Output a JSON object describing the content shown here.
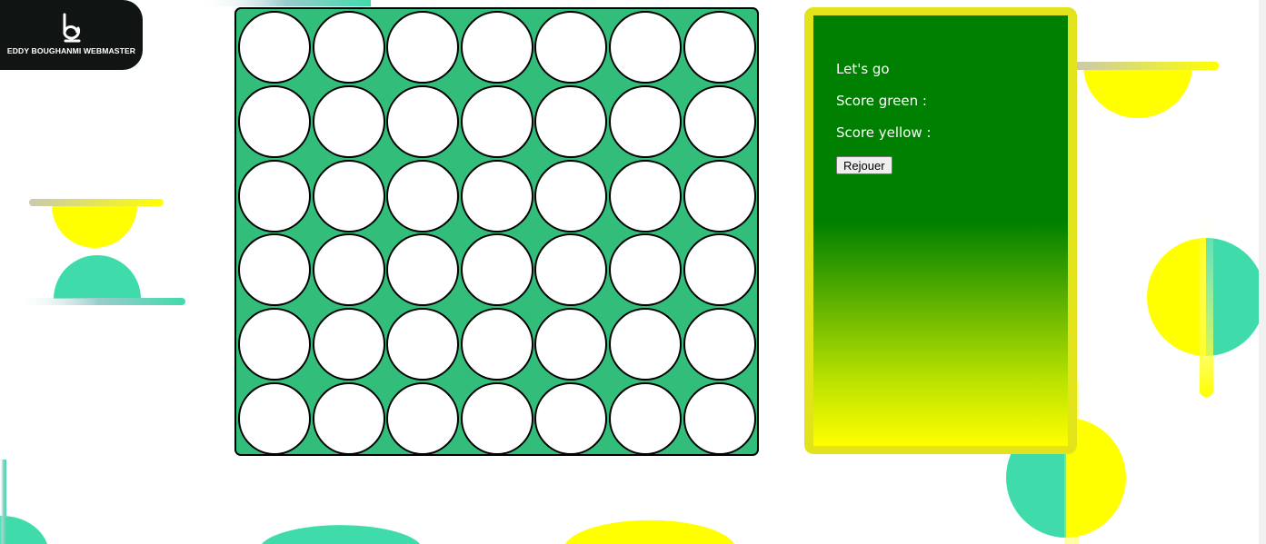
{
  "logo": {
    "mark": "b",
    "name": "EDDY BOUGHANMI WEBMASTER"
  },
  "board": {
    "rows": 6,
    "columns": 7,
    "cell_color": "#ffffff",
    "board_color": "#32bd7a"
  },
  "panel": {
    "status": "Let's go",
    "score_green_label": "Score green :",
    "score_yellow_label": "Score yellow :",
    "replay_label": "Rejouer"
  },
  "colors": {
    "green": "#008000",
    "yellow": "#ffff00",
    "teal": "#40dbab",
    "panel_border": "#e3e31b"
  }
}
